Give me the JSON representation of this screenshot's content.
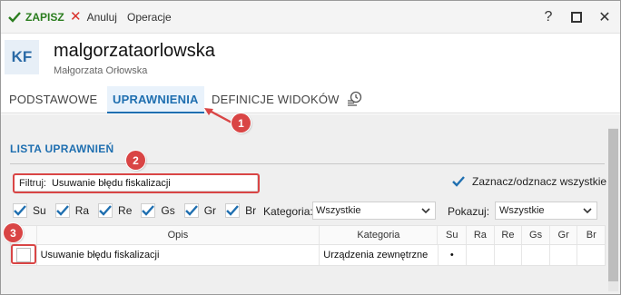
{
  "toolbar": {
    "save_label": "ZAPISZ",
    "cancel_label": "Anuluj",
    "operations_label": "Operacje",
    "help_label": "?",
    "close_label": "✕"
  },
  "header": {
    "avatar_initials": "KF",
    "login": "malgorzataorlowska",
    "full_name": "Małgorzata Orłowska"
  },
  "tabs": [
    {
      "label": "PODSTAWOWE"
    },
    {
      "label": "UPRAWNIENIA",
      "active": true
    },
    {
      "label": "DEFINICJE WIDOKÓW"
    }
  ],
  "section": {
    "title": "LISTA UPRAWNIEŃ"
  },
  "filter": {
    "label": "Filtruj:",
    "value": "Usuwanie błędu fiskalizacji"
  },
  "select_all": {
    "label": "Zaznacz/odznacz wszystkie",
    "checked": true
  },
  "types": [
    {
      "label": "Su",
      "checked": true
    },
    {
      "label": "Ra",
      "checked": true
    },
    {
      "label": "Re",
      "checked": true
    },
    {
      "label": "Gs",
      "checked": true
    },
    {
      "label": "Gr",
      "checked": true
    },
    {
      "label": "Br",
      "checked": true
    }
  ],
  "category_filter": {
    "label": "Kategoria:",
    "value": "Wszystkie"
  },
  "show_filter": {
    "label": "Pokazuj:",
    "value": "Wszystkie"
  },
  "table": {
    "columns": [
      "",
      "Opis",
      "Kategoria",
      "Su",
      "Ra",
      "Re",
      "Gs",
      "Gr",
      "Br"
    ],
    "rows": [
      {
        "checked": false,
        "opis": "Usuwanie błędu fiskalizacji",
        "kategoria": "Urządzenia zewnętrzne",
        "su": "•",
        "ra": "",
        "re": "",
        "gs": "",
        "gr": "",
        "br": ""
      }
    ]
  },
  "callouts": [
    "1",
    "2",
    "3"
  ],
  "colors": {
    "accent": "#1f6fb0",
    "save_green": "#2b7d1f",
    "cancel_red": "#d9302b",
    "callout_red": "#d94545"
  },
  "icons": {
    "save": "check-icon",
    "cancel": "x-icon",
    "help": "question-icon",
    "maximize": "maximize-icon",
    "close": "close-icon",
    "history_tab": "history-icon"
  }
}
